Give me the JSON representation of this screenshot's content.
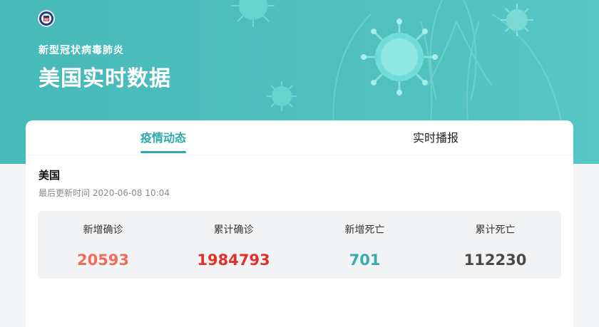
{
  "header": {
    "subtitle": "新型冠状病毒肺炎",
    "title": "美国实时数据"
  },
  "tabs": [
    {
      "label": "疫情动态",
      "active": true
    },
    {
      "label": "实时播报",
      "active": false
    }
  ],
  "summary": {
    "country": "美国",
    "update_time": "最后更新时间 2020-06-08 10:04"
  },
  "stats": [
    {
      "label": "新增确诊",
      "value": "20593",
      "color": "#ef6e5a"
    },
    {
      "label": "累计确诊",
      "value": "1984793",
      "color": "#e0322b"
    },
    {
      "label": "新增死亡",
      "value": "701",
      "color": "#3aa9b0"
    },
    {
      "label": "累计死亡",
      "value": "112230",
      "color": "#4a4a4a"
    }
  ],
  "colors": {
    "hero_bg": "#4fc0be",
    "accent": "#2ea9ad",
    "card_bg": "#ffffff"
  }
}
